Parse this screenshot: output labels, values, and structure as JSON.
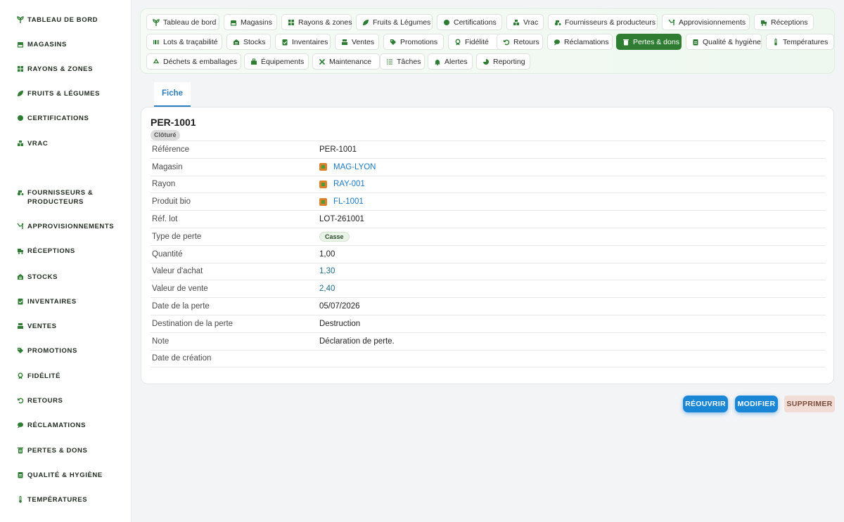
{
  "colors": {
    "accent": "#2f7d32",
    "link": "#1b79c1",
    "primary_button": "#1a86d6"
  },
  "sidebar": {
    "items": [
      {
        "label": "Tableau de bord",
        "icon": "sprout-icon"
      },
      {
        "label": "Magasins",
        "icon": "store-icon"
      },
      {
        "label": "Rayons & zones",
        "icon": "grid-icon"
      },
      {
        "label": "Fruits & Légumes",
        "icon": "leaf-icon"
      },
      {
        "label": "Certifications",
        "icon": "badge-icon"
      },
      {
        "label": "Vrac",
        "icon": "bulk-icon"
      },
      {
        "label": "Fournisseurs & producteurs",
        "icon": "tractor-icon"
      },
      {
        "label": "Approvisionnements",
        "icon": "supply-icon"
      },
      {
        "label": "Réceptions",
        "icon": "truck-icon"
      },
      {
        "label": "Stocks",
        "icon": "warehouse-icon"
      },
      {
        "label": "Inventaires",
        "icon": "clipboard-check-icon"
      },
      {
        "label": "Ventes",
        "icon": "cash-register-icon"
      },
      {
        "label": "Promotions",
        "icon": "tag-icon"
      },
      {
        "label": "Fidélité",
        "icon": "award-icon"
      },
      {
        "label": "Retours",
        "icon": "undo-icon"
      },
      {
        "label": "Réclamations",
        "icon": "comment-icon"
      },
      {
        "label": "Pertes & dons",
        "icon": "trash-icon"
      },
      {
        "label": "Qualité & hygiène",
        "icon": "clipboard-icon"
      },
      {
        "label": "Températures",
        "icon": "thermometer-icon"
      }
    ]
  },
  "topnav": {
    "items": [
      {
        "label": "Tableau de bord",
        "icon": "sprout-icon"
      },
      {
        "label": "Magasins",
        "icon": "store-icon"
      },
      {
        "label": "Rayons & zones",
        "icon": "grid-icon"
      },
      {
        "label": "Fruits & Légumes",
        "icon": "leaf-icon"
      },
      {
        "label": "Certifications",
        "icon": "badge-icon"
      },
      {
        "label": "Vrac",
        "icon": "bulk-icon"
      },
      {
        "label": "Fournisseurs & producteurs",
        "icon": "tractor-icon"
      },
      {
        "label": "Approvisionnements",
        "icon": "supply-icon"
      },
      {
        "label": "Réceptions",
        "icon": "truck-icon"
      },
      {
        "label": "Lots & traçabilité",
        "icon": "barcode-icon"
      },
      {
        "label": "Stocks",
        "icon": "warehouse-icon"
      },
      {
        "label": "Inventaires",
        "icon": "clipboard-check-icon"
      },
      {
        "label": "Ventes",
        "icon": "cash-register-icon"
      },
      {
        "label": "Promotions",
        "icon": "tag-icon"
      },
      {
        "label": "Fidélité",
        "icon": "award-icon"
      },
      {
        "label": "Retours",
        "icon": "undo-icon"
      },
      {
        "label": "Réclamations",
        "icon": "comment-icon"
      },
      {
        "label": "Pertes & dons",
        "icon": "trash-icon",
        "active": true
      },
      {
        "label": "Qualité & hygiène",
        "icon": "clipboard-icon"
      },
      {
        "label": "Températures",
        "icon": "thermometer-icon"
      },
      {
        "label": "Déchets & emballages",
        "icon": "recycle-icon"
      },
      {
        "label": "Équipements",
        "icon": "toolbox-icon"
      },
      {
        "label": "Maintenance",
        "icon": "wrench-icon"
      },
      {
        "label": "Tâches",
        "icon": "list-icon"
      },
      {
        "label": "Alertes",
        "icon": "bell-icon"
      },
      {
        "label": "Reporting",
        "icon": "pie-chart-icon"
      }
    ]
  },
  "tabs": {
    "active": "Fiche"
  },
  "record": {
    "title": "PER-1001",
    "status": "Clôturé",
    "fields": [
      {
        "label": "Référence",
        "value": "PER-1001"
      },
      {
        "label": "Magasin",
        "value": "MAG-LYON",
        "kind": "link"
      },
      {
        "label": "Rayon",
        "value": "RAY-001",
        "kind": "link"
      },
      {
        "label": "Produit bio",
        "value": "FL-1001",
        "kind": "link"
      },
      {
        "label": "Réf. lot",
        "value": "LOT-261001"
      },
      {
        "label": "Type de perte",
        "value": "Casse",
        "kind": "badge"
      },
      {
        "label": "Quantité",
        "value": "1,00"
      },
      {
        "label": "Valeur d'achat",
        "value": "1,30",
        "kind": "money"
      },
      {
        "label": "Valeur de vente",
        "value": "2,40",
        "kind": "money"
      },
      {
        "label": "Date de la perte",
        "value": "05/07/2026"
      },
      {
        "label": "Destination de la perte",
        "value": "Destruction"
      },
      {
        "label": "Note",
        "value": "Déclaration de perte."
      },
      {
        "label": "Date de création",
        "value": ""
      }
    ]
  },
  "actions": {
    "reopen": "Réouvrir",
    "edit": "Modifier",
    "delete": "Supprimer"
  }
}
